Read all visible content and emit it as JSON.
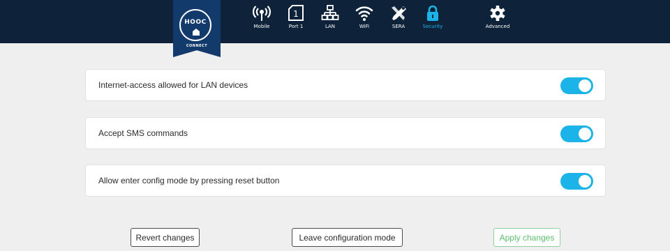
{
  "brand": {
    "name": "HOOC",
    "subtitle": "CONNECT"
  },
  "nav": {
    "items": [
      {
        "label": "Mobile",
        "icon": "mobile-antenna-icon",
        "active": false
      },
      {
        "label": "Port 1",
        "icon": "port-icon",
        "active": false
      },
      {
        "label": "LAN",
        "icon": "lan-network-icon",
        "active": false
      },
      {
        "label": "WiFi",
        "icon": "wifi-icon",
        "active": false
      },
      {
        "label": "SERA",
        "icon": "sera-tools-icon",
        "active": false
      },
      {
        "label": "Security",
        "icon": "lock-icon",
        "active": true
      },
      {
        "label": "Advanced",
        "icon": "gear-icon",
        "active": false
      }
    ],
    "port_number": "1"
  },
  "settings": [
    {
      "label": "Internet-access allowed for LAN devices",
      "enabled": true
    },
    {
      "label": "Accept SMS commands",
      "enabled": true
    },
    {
      "label": "Allow enter config mode by pressing reset button",
      "enabled": true
    }
  ],
  "actions": {
    "revert_label": "Revert changes",
    "leave_label": "Leave configuration mode",
    "apply_label": "Apply changes"
  },
  "colors": {
    "header_bg": "#0e2239",
    "accent": "#1cb4e8",
    "apply_green": "#5bbf6e"
  }
}
